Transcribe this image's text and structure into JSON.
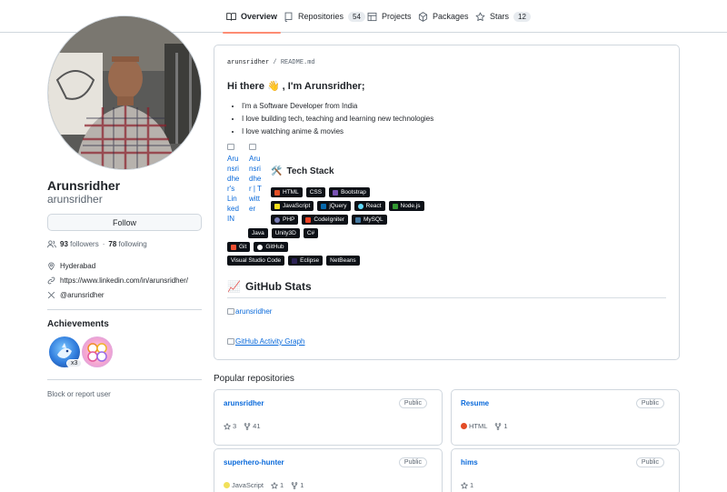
{
  "nav": {
    "tabs": [
      {
        "label": "Overview",
        "count": ""
      },
      {
        "label": "Repositories",
        "count": "54"
      },
      {
        "label": "Projects",
        "count": ""
      },
      {
        "label": "Packages",
        "count": ""
      },
      {
        "label": "Stars",
        "count": "12"
      }
    ]
  },
  "profile": {
    "name": "Arunsridher",
    "login": "arunsridher",
    "follow_label": "Follow",
    "followers_count": "93",
    "followers_label": "followers",
    "separator": "·",
    "following_count": "78",
    "following_label": "following",
    "location": "Hyderabad",
    "website": "https://www.linkedin.com/in/arunsridher/",
    "social": "@arunsridher",
    "achievements_title": "Achievements",
    "achievement_count": "x3",
    "block_label": "Block or report user"
  },
  "readme": {
    "owner": "arunsridher",
    "slash": "/",
    "file": "README.md",
    "greeting": "Hi there",
    "greeting_emoji": "👋",
    "greeting_rest": ", I'm Arunsridher;",
    "bullets": [
      "I'm a Software Developer from India",
      "I love building tech, teaching and learning new technologies",
      "I love watching anime & movies"
    ],
    "alt_linkedin": "Arunsridher's LinkedIN",
    "alt_twitter": "Arunsridher | Twitter",
    "tech_emoji": "🛠️",
    "tech_title": "Tech Stack",
    "tech_rows": [
      [
        {
          "label": "HTML",
          "color": "#e34f26"
        },
        {
          "label": "CSS",
          "color": ""
        },
        {
          "label": "Bootstrap",
          "color": "#7952b3"
        }
      ],
      [
        {
          "label": "JavaScript",
          "color": "#f7df1e"
        },
        {
          "label": "jQuery",
          "color": "#0769ad"
        },
        {
          "label": "React",
          "color": "#61dafb"
        },
        {
          "label": "Node.js",
          "color": "#339933"
        }
      ],
      [
        {
          "label": "PHP",
          "color": "#777bb4"
        },
        {
          "label": "CodeIgniter",
          "color": "#ef4223"
        },
        {
          "label": "MySQL",
          "color": "#4479a1"
        }
      ],
      [
        {
          "label": "Java",
          "color": ""
        },
        {
          "label": "Unity3D",
          "color": ""
        },
        {
          "label": "C#",
          "color": ""
        }
      ],
      [
        {
          "label": "Git",
          "color": "#f05032"
        },
        {
          "label": "GitHub",
          "color": "#ffffff"
        }
      ],
      [
        {
          "label": "Visual Studio Code",
          "color": ""
        },
        {
          "label": "Eclipse",
          "color": "#2c2255"
        },
        {
          "label": "NetBeans",
          "color": ""
        }
      ]
    ],
    "stats_emoji": "📈",
    "stats_title": "GitHub Stats",
    "stats_img_alt": "arunsridher",
    "activity_img_alt": "GitHub Activity Graph"
  },
  "popular": {
    "title": "Popular repositories",
    "repos": [
      {
        "name": "arunsridher",
        "visibility": "Public",
        "language": "",
        "lang_color": "",
        "stars": "3",
        "forks": "41"
      },
      {
        "name": "Resume",
        "visibility": "Public",
        "language": "HTML",
        "lang_color": "#e34c26",
        "stars": "",
        "forks": "1"
      },
      {
        "name": "superhero-hunter",
        "visibility": "Public",
        "language": "JavaScript",
        "lang_color": "#f1e05a",
        "stars": "1",
        "forks": "1"
      },
      {
        "name": "hims",
        "visibility": "Public",
        "language": "",
        "lang_color": "",
        "stars": "1",
        "forks": ""
      }
    ]
  }
}
